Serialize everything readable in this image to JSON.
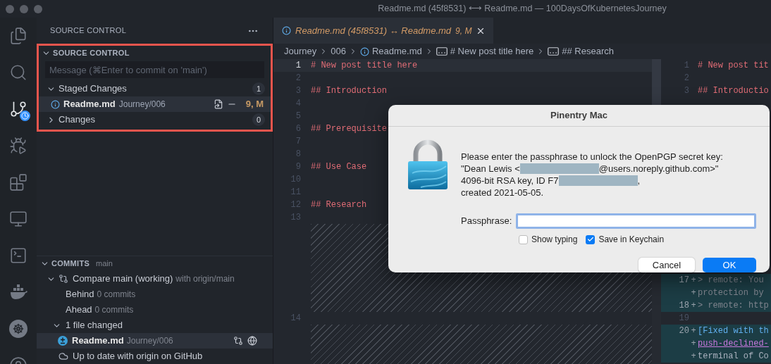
{
  "window": {
    "title": "Readme.md (45f8531) ⟷ Readme.md — 100DaysOfKubernetesJourney"
  },
  "activity_bar": [
    {
      "selected": false
    },
    {
      "selected": false
    },
    {
      "selected": true
    },
    {
      "selected": false
    },
    {
      "selected": false
    },
    {
      "selected": false
    },
    {
      "selected": false
    },
    {
      "selected": false
    },
    {
      "selected": false
    },
    {
      "selected": false
    }
  ],
  "sidebar": {
    "title": "SOURCE CONTROL",
    "source_control": {
      "title": "SOURCE CONTROL",
      "expanded": true,
      "message_placeholder": "Message (⌘Enter to commit on 'main')",
      "groups": [
        {
          "label": "Staged Changes",
          "count": "1",
          "expanded": true,
          "files": [
            {
              "name": "Readme.md",
              "path": "Journey/006",
              "status": "9, M",
              "selected": true
            }
          ]
        },
        {
          "label": "Changes",
          "count": "0",
          "expanded": false
        }
      ]
    },
    "commits": {
      "title": "COMMITS",
      "branch": "main",
      "expanded": true,
      "tree": [
        {
          "kind": "compare",
          "label": "Compare main (working)",
          "detail": "with origin/main",
          "expanded": true,
          "selected": false,
          "children": [
            {
              "label": "Behind",
              "detail": "0 commits",
              "selected": false
            },
            {
              "label": "Ahead",
              "detail": "0 commits",
              "selected": false
            },
            {
              "label": "1 file changed",
              "expanded": true,
              "selected": false,
              "children": [
                {
                  "kind": "file",
                  "label": "Readme.md",
                  "detail": "Journey/006",
                  "selected": true
                }
              ]
            }
          ]
        },
        {
          "kind": "status",
          "label": "Up to date with origin on GitHub",
          "selected": false
        }
      ]
    }
  },
  "editor": {
    "tab": {
      "title": "Readme.md (45f8531) ↔ Readme.md",
      "badge": "9, M",
      "selected": true
    },
    "breadcrumbs": [
      {
        "kind": "folder",
        "text": "Journey"
      },
      {
        "kind": "folder",
        "text": "006"
      },
      {
        "kind": "file",
        "text": "Readme.md"
      },
      {
        "kind": "symbol",
        "text": "# New post title here"
      },
      {
        "kind": "symbol",
        "text": "## Research"
      }
    ],
    "left_pane": {
      "lines": [
        {
          "kind": "heading",
          "number": "1",
          "text": "# New post title here",
          "current": true
        },
        {
          "kind": "blank",
          "number": "2",
          "current": false
        },
        {
          "kind": "heading",
          "number": "3",
          "text": "## Introduction",
          "current": false
        },
        {
          "kind": "blank",
          "number": "4",
          "current": false
        },
        {
          "kind": "blank",
          "number": "5",
          "current": false
        },
        {
          "kind": "heading",
          "number": "6",
          "text": "## Prerequisite",
          "current": false
        },
        {
          "kind": "blank",
          "number": "7",
          "current": false
        },
        {
          "kind": "blank",
          "number": "8",
          "current": false
        },
        {
          "kind": "heading",
          "number": "9",
          "text": "## Use Case",
          "current": false
        },
        {
          "kind": "blank",
          "number": "10",
          "current": false
        },
        {
          "kind": "blank",
          "number": "11",
          "current": false
        },
        {
          "kind": "heading",
          "number": "12",
          "text": "## Research",
          "current": false
        },
        {
          "kind": "blank",
          "number": "13",
          "current": false
        },
        {
          "kind": "filler"
        },
        {
          "kind": "blank",
          "number": "14",
          "current": false
        },
        {
          "kind": "filler"
        }
      ]
    },
    "right_pane": {
      "top_lines": [
        {
          "kind": "heading",
          "number": "1",
          "text": "# New post tit",
          "added": false
        },
        {
          "kind": "blank",
          "number": "2",
          "added": false
        },
        {
          "kind": "heading",
          "number": "3",
          "text": "## Introductio",
          "added": false
        }
      ],
      "bottom_lines": [
        {
          "kind": "quote",
          "number": "17",
          "marker": "+",
          "text": "> remote: You ",
          "added": true
        },
        {
          "kind": "quote",
          "marker": "+",
          "text": "protection by ",
          "added": true
        },
        {
          "kind": "quote",
          "number": "18",
          "marker": "+",
          "text": "> remote: http",
          "added": true
        },
        {
          "kind": "blank",
          "number": "19",
          "added": false
        },
        {
          "kind": "link-text",
          "number": "20",
          "marker": "+",
          "text": "[Fixed with th",
          "added": true
        },
        {
          "kind": "link-url",
          "marker": "+",
          "text": "push-declined-",
          "added": true
        },
        {
          "kind": "text",
          "marker": "+",
          "text": "terminal of Co",
          "added": true
        }
      ]
    }
  },
  "dialog": {
    "title": "Pinentry Mac",
    "message": [
      [
        {
          "kind": "text",
          "text": "Please enter the passphrase to unlock the OpenPGP secret key:"
        }
      ],
      [
        {
          "kind": "text",
          "text": "\"Dean Lewis <"
        },
        {
          "kind": "redacted"
        },
        {
          "kind": "text",
          "text": "@users.noreply.github.com>\""
        }
      ],
      [
        {
          "kind": "text",
          "text": "4096-bit RSA key, ID F7"
        },
        {
          "kind": "redacted"
        },
        {
          "kind": "text",
          "text": ","
        }
      ],
      [
        {
          "kind": "text",
          "text": "created 2021-05-05."
        }
      ]
    ],
    "passphrase": {
      "label": "Passphrase:",
      "focused": true
    },
    "checkboxes": [
      {
        "label": "Show typing",
        "checked": false
      },
      {
        "label": "Save in Keychain",
        "checked": true
      }
    ],
    "buttons": [
      {
        "label": "Cancel",
        "kind": "secondary"
      },
      {
        "label": "OK",
        "kind": "primary"
      }
    ]
  }
}
